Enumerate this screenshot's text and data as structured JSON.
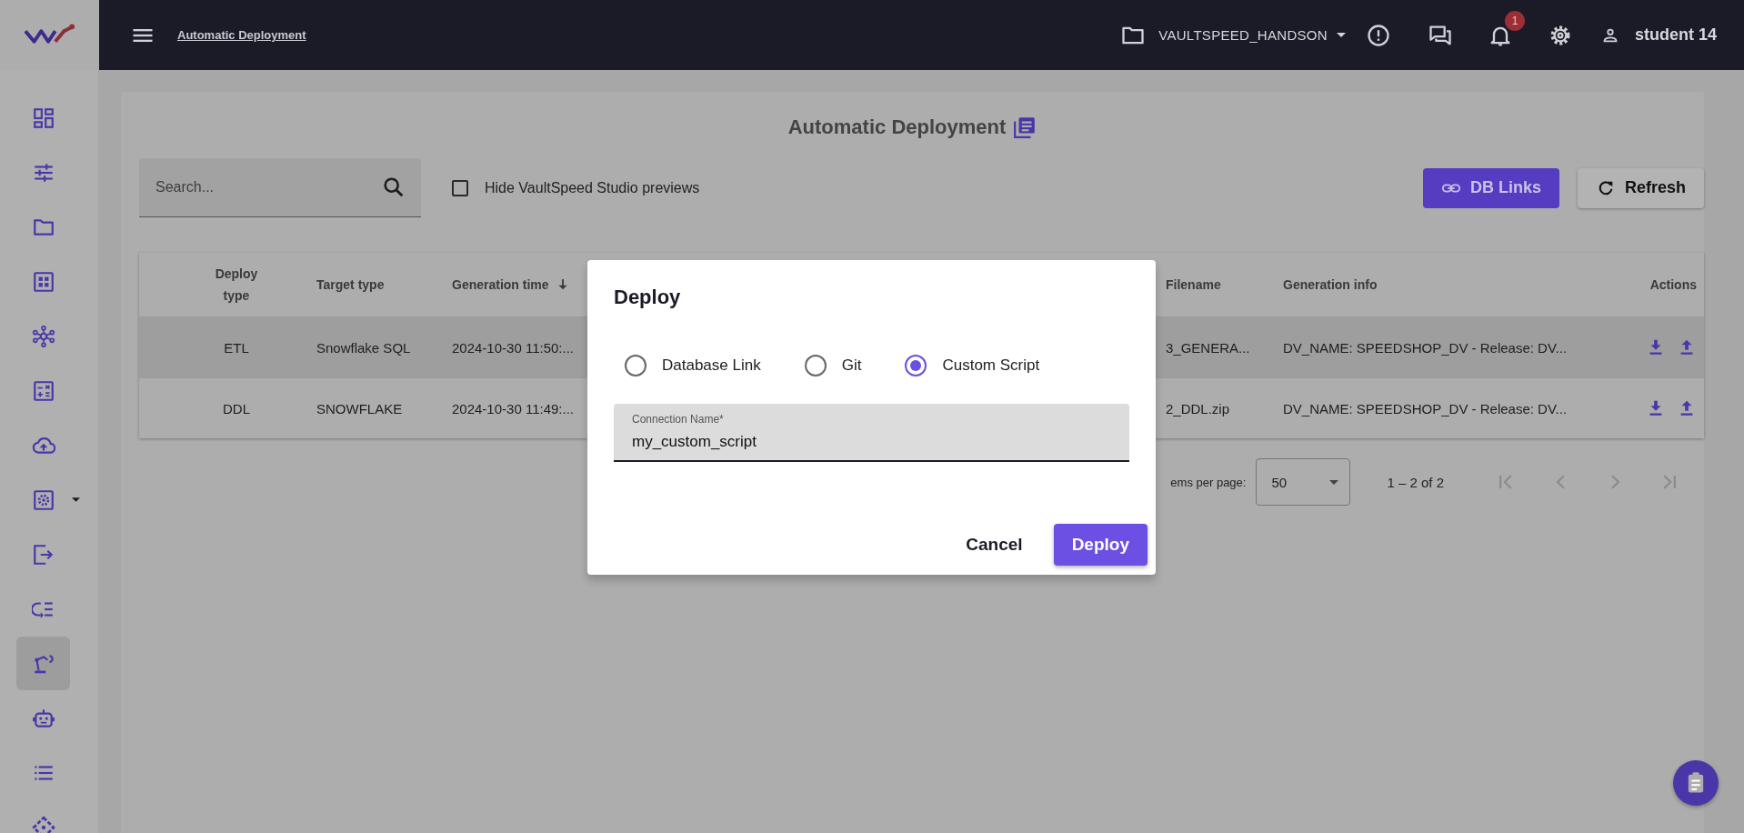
{
  "top_bar": {
    "breadcrumb": "Automatic Deployment",
    "project": "VAULTSPEED_HANDSON",
    "notification_count": "1",
    "user": "student 14"
  },
  "sidebar": {
    "items": [
      {
        "selected": false
      },
      {
        "selected": false
      },
      {
        "selected": false
      },
      {
        "selected": false
      },
      {
        "selected": false
      },
      {
        "selected": false
      },
      {
        "selected": false
      },
      {
        "selected": false
      },
      {
        "selected": false
      },
      {
        "selected": false
      },
      {
        "selected": true
      },
      {
        "selected": false
      },
      {
        "selected": false
      },
      {
        "selected": false
      }
    ]
  },
  "page": {
    "title": "Automatic Deployment",
    "search": {
      "placeholder": "Search..."
    },
    "hide_previews": {
      "label": "Hide VaultSpeed Studio previews",
      "checked": false
    },
    "buttons": [
      "DB Links",
      "Refresh"
    ]
  },
  "table": {
    "columns": [
      {
        "label": "Deploy type",
        "sorted": false
      },
      {
        "label": "Target type",
        "sorted": false
      },
      {
        "label": "Generation time",
        "sorted": true
      },
      {
        "label": "Filename",
        "sorted": false
      },
      {
        "label": "Generation info",
        "sorted": false
      },
      {
        "label": "Actions",
        "sorted": false
      }
    ],
    "rows": [
      {
        "deploy_type": "ETL",
        "target_type": "Snowflake SQL",
        "generation_time": "2024-10-30 11:50:...",
        "filename": "3_GENERA...",
        "generation_info": "DV_NAME: SPEEDSHOP_DV - Release: DV...",
        "selected": true
      },
      {
        "deploy_type": "DDL",
        "target_type": "SNOWFLAKE",
        "generation_time": "2024-10-30 11:49:...",
        "filename": "2_DDL.zip",
        "generation_info": "DV_NAME: SPEEDSHOP_DV - Release: DV...",
        "selected": false
      }
    ]
  },
  "pagination": {
    "items_per_page_label": "ems per page:",
    "page_size": "50",
    "range": "1 – 2 of 2",
    "nav_buttons": [
      {
        "disabled": true
      },
      {
        "disabled": true
      },
      {
        "disabled": true
      },
      {
        "disabled": true
      }
    ]
  },
  "dialog": {
    "title": "Deploy",
    "options": [
      {
        "label": "Database Link",
        "selected": false
      },
      {
        "label": "Git",
        "selected": false
      },
      {
        "label": "Custom Script",
        "selected": true
      }
    ],
    "field": {
      "label": "Connection Name*",
      "value": "my_custom_script"
    },
    "buttons": [
      {
        "label": "Cancel",
        "kind": "text"
      },
      {
        "label": "Deploy",
        "kind": "primary"
      }
    ]
  }
}
